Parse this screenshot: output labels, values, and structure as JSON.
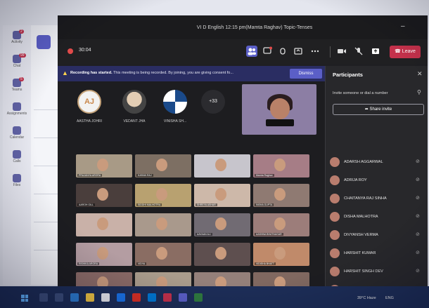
{
  "window": {
    "title": "VI D English 12:15 pm(Mamta Raghav) Topic-Tenses",
    "minimize": "–"
  },
  "rail": [
    {
      "name": "activity",
      "label": "Activity",
      "badge": "2"
    },
    {
      "name": "chat",
      "label": "Chat",
      "badge": "99"
    },
    {
      "name": "teams",
      "label": "Teams",
      "badge": "5"
    },
    {
      "name": "assignments",
      "label": "Assignments",
      "badge": ""
    },
    {
      "name": "calendar",
      "label": "Calendar",
      "badge": ""
    },
    {
      "name": "calls",
      "label": "Calls",
      "badge": ""
    },
    {
      "name": "files",
      "label": "Files",
      "badge": ""
    }
  ],
  "toolbar": {
    "timer": "30:04",
    "leave_label": "Leave"
  },
  "banner": {
    "bold": "Recording has started.",
    "text": "This meeting is being recorded. By joining, you are giving consent fo...",
    "dismiss": "Dismiss"
  },
  "avatars": [
    {
      "initials": "AJ",
      "name": "AASTHA JOHRI"
    },
    {
      "initials": "",
      "name": "VEDANT JHA"
    },
    {
      "initials": "",
      "name": "VINISHA SH..."
    },
    {
      "initials": "+33",
      "name": ""
    }
  ],
  "tiles": [
    {
      "name": "PRAJANYA ARORA",
      "color": "#a89a86"
    },
    {
      "name": "KARAN RAJ",
      "color": "#7d6f63"
    },
    {
      "name": "",
      "color": "#c7c5cc"
    },
    {
      "name": "Mamta Raghav",
      "color": "#a67d86"
    },
    {
      "name": "AAROH GILL",
      "color": "#4a3e3c"
    },
    {
      "name": "SIDDHI MALHOTRA",
      "color": "#b8a170"
    },
    {
      "name": "SHREYA ASHAR",
      "color": "#cdb8a9"
    },
    {
      "name": "INSHA GUPTA",
      "color": "#8f7a72"
    },
    {
      "name": "",
      "color": "#c9b1a8"
    },
    {
      "name": "",
      "color": "#a9998c"
    },
    {
      "name": "AAYAAN ALI",
      "color": "#716b73"
    },
    {
      "name": "AASHNA BHATNAGAR",
      "color": "#9c7d7a"
    },
    {
      "name": "RISHIKA ARORA",
      "color": "#b49da2"
    },
    {
      "name": "VIDYA",
      "color": "#8a6d63"
    },
    {
      "name": "",
      "color": "#5e4f4f"
    },
    {
      "name": "VIDISHA BHATT",
      "color": "#c08a6a"
    },
    {
      "name": "ANISHA SHARMA",
      "color": "#8b6b67"
    },
    {
      "name": "RAHUL YADAV",
      "color": "#aa9c8c"
    },
    {
      "name": "",
      "color": "#94807a"
    },
    {
      "name": "AKSHAT SINGH DEO",
      "color": "#806860"
    }
  ],
  "panel": {
    "title": "Participants",
    "invite": "Invite someone or dial a number",
    "share": "Share invite",
    "people": [
      "ADARSH AGGARWAL",
      "ADRIJA ROY",
      "CHAITANYA RAJ SINHA",
      "DISHA MALHOTRA",
      "DIVYANSH VERMA",
      "HARSHIT KUMAR",
      "HARSHIT SINGH DEV",
      "HARSHITA"
    ]
  },
  "taskbar": {
    "weather": "39°C Haze",
    "tray": "ENG"
  }
}
